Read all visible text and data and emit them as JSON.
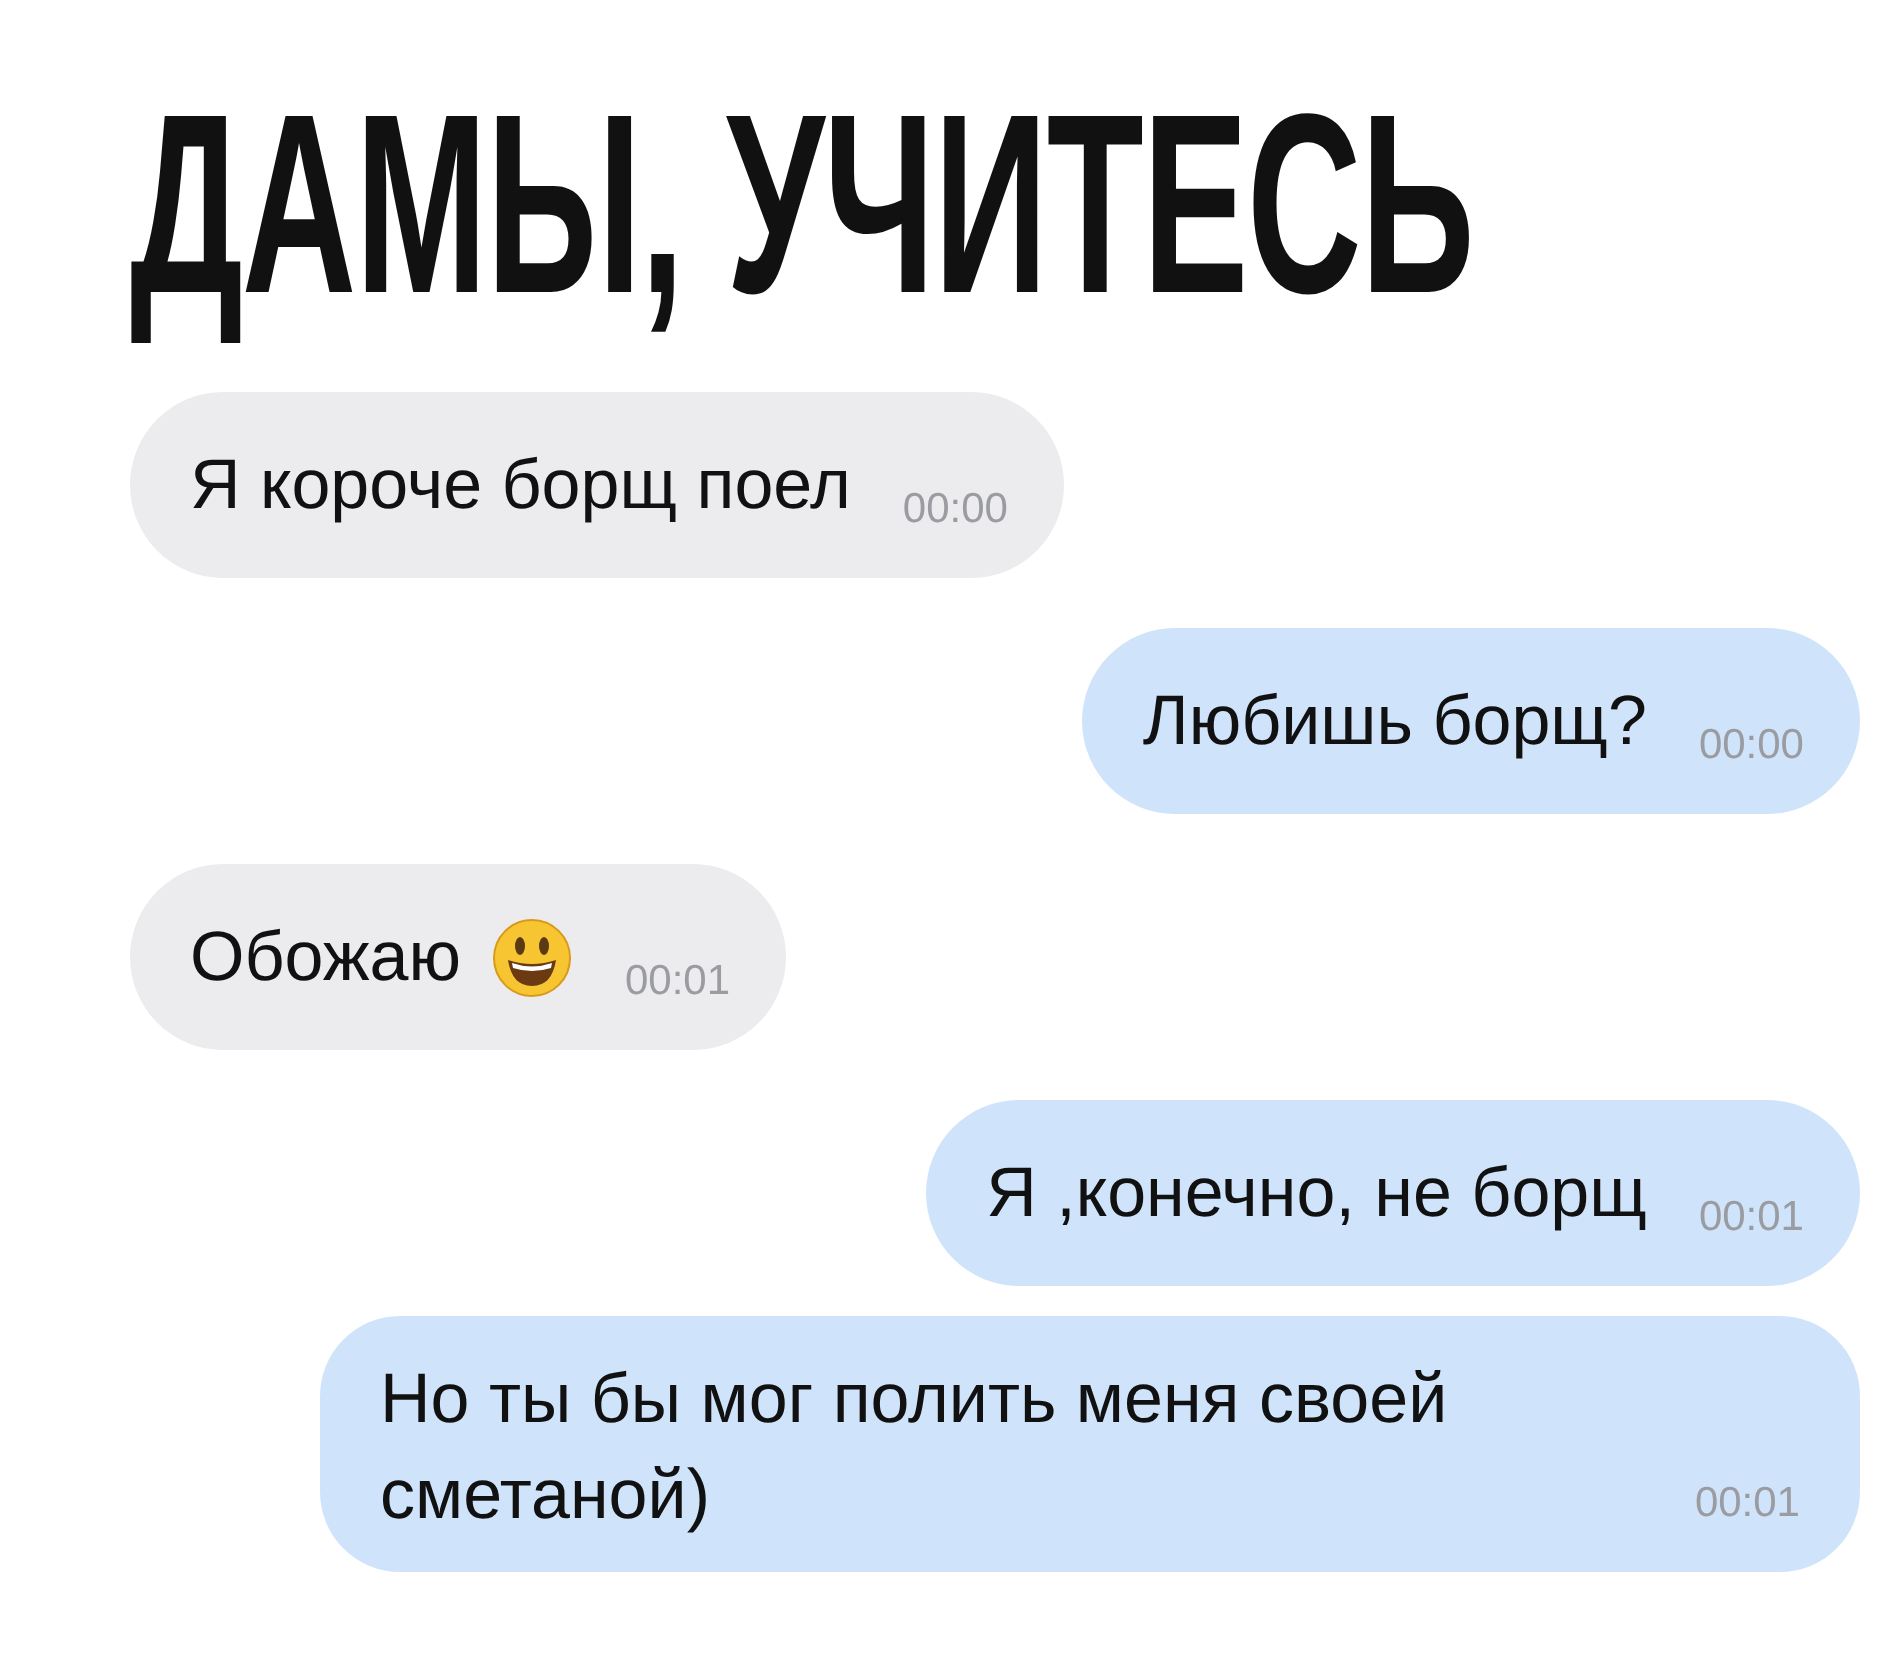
{
  "title": "ДАМЫ, УЧИТЕСЬ",
  "messages": [
    {
      "kind": "incoming",
      "text": "Я короче борщ поел",
      "emoji": false,
      "time": "00:00"
    },
    {
      "kind": "outgoing",
      "text": "Любишь борщ?",
      "emoji": false,
      "time": "00:00"
    },
    {
      "kind": "incoming",
      "text": "Обожаю",
      "emoji": true,
      "time": "00:01"
    },
    {
      "kind": "outgoing",
      "text": "Я ,конечно, не борщ",
      "emoji": false,
      "time": "00:01"
    },
    {
      "kind": "outgoing",
      "text": "Но ты бы мог полить меня своей сметаной)",
      "emoji": false,
      "time": "00:01"
    }
  ]
}
